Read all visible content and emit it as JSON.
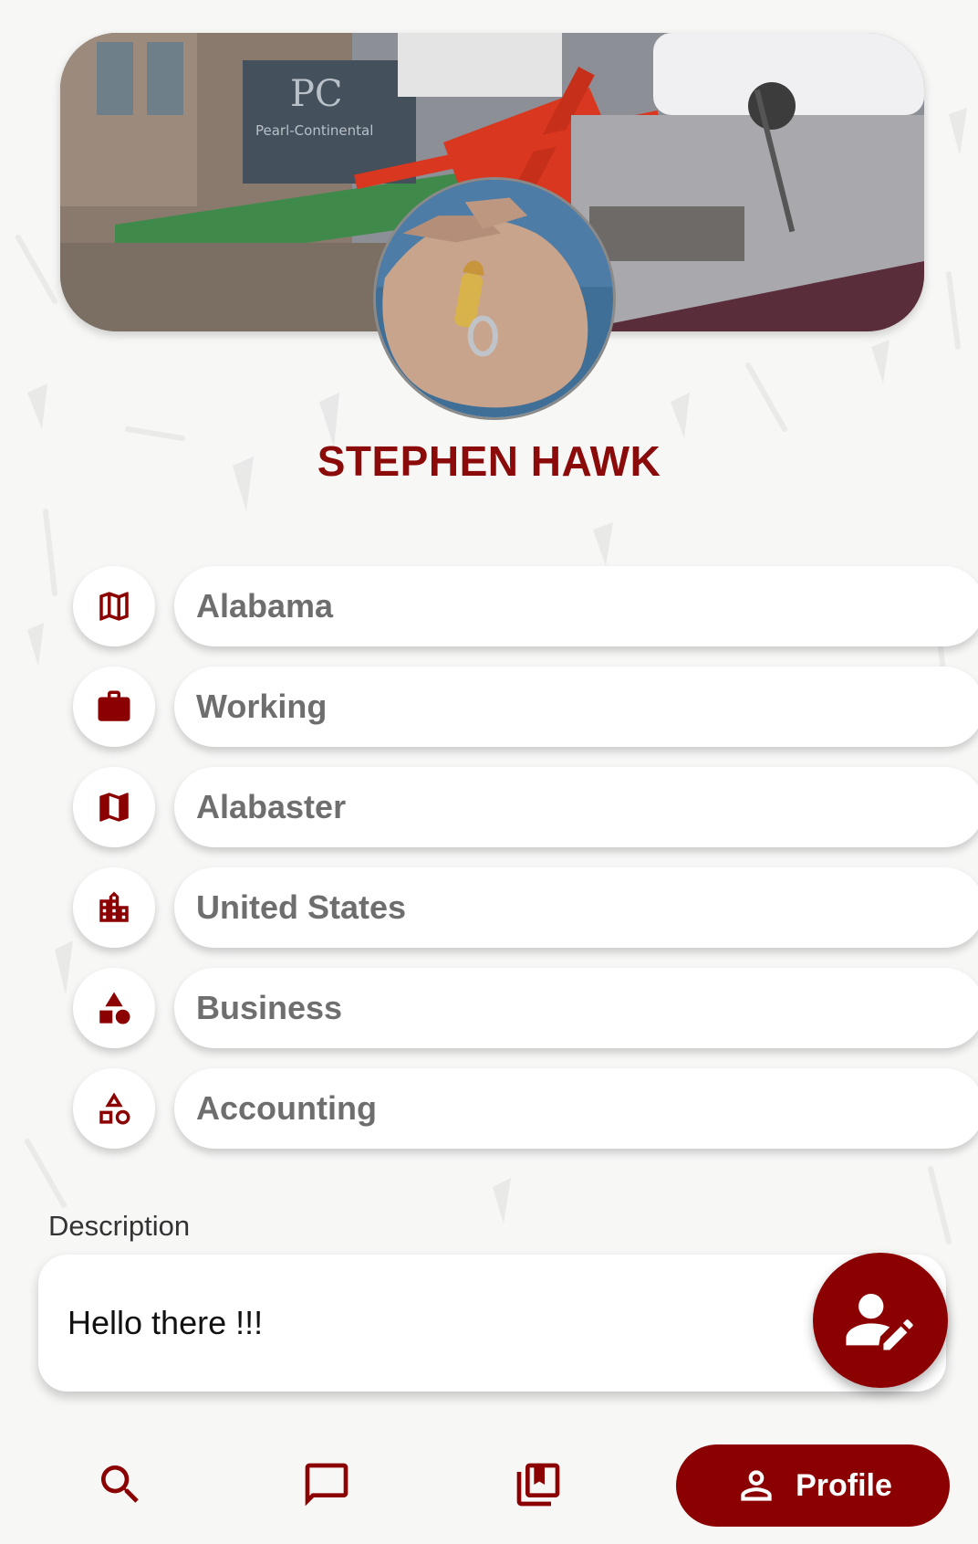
{
  "profile": {
    "name": "STEPHEN HAWK"
  },
  "info_fields": [
    {
      "icon": "map-outline-icon",
      "value": "Alabama"
    },
    {
      "icon": "briefcase-icon",
      "value": "Working"
    },
    {
      "icon": "map-filled-icon",
      "value": "Alabaster"
    },
    {
      "icon": "city-icon",
      "value": "United States"
    },
    {
      "icon": "shapes-filled-icon",
      "value": "Business"
    },
    {
      "icon": "shapes-outline-icon",
      "value": "Accounting"
    }
  ],
  "description": {
    "label": "Description",
    "text": "Hello there !!!"
  },
  "fab": {
    "icon": "edit-profile-icon"
  },
  "bottom_nav": {
    "items": [
      {
        "icon": "search-icon"
      },
      {
        "icon": "chat-icon"
      },
      {
        "icon": "bookmarks-icon"
      }
    ],
    "active_label": "Profile",
    "active_icon": "person-icon"
  },
  "colors": {
    "accent": "#8b0000",
    "background": "#f7f7f6",
    "field_text": "#6e6e6e"
  }
}
